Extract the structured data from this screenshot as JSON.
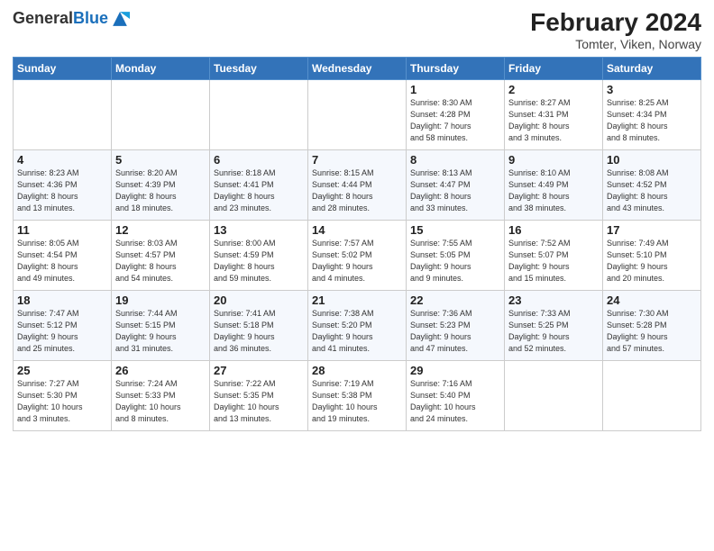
{
  "logo": {
    "general": "General",
    "blue": "Blue"
  },
  "title": "February 2024",
  "subtitle": "Tomter, Viken, Norway",
  "headers": [
    "Sunday",
    "Monday",
    "Tuesday",
    "Wednesday",
    "Thursday",
    "Friday",
    "Saturday"
  ],
  "weeks": [
    [
      {
        "day": "",
        "detail": ""
      },
      {
        "day": "",
        "detail": ""
      },
      {
        "day": "",
        "detail": ""
      },
      {
        "day": "",
        "detail": ""
      },
      {
        "day": "1",
        "detail": "Sunrise: 8:30 AM\nSunset: 4:28 PM\nDaylight: 7 hours\nand 58 minutes."
      },
      {
        "day": "2",
        "detail": "Sunrise: 8:27 AM\nSunset: 4:31 PM\nDaylight: 8 hours\nand 3 minutes."
      },
      {
        "day": "3",
        "detail": "Sunrise: 8:25 AM\nSunset: 4:34 PM\nDaylight: 8 hours\nand 8 minutes."
      }
    ],
    [
      {
        "day": "4",
        "detail": "Sunrise: 8:23 AM\nSunset: 4:36 PM\nDaylight: 8 hours\nand 13 minutes."
      },
      {
        "day": "5",
        "detail": "Sunrise: 8:20 AM\nSunset: 4:39 PM\nDaylight: 8 hours\nand 18 minutes."
      },
      {
        "day": "6",
        "detail": "Sunrise: 8:18 AM\nSunset: 4:41 PM\nDaylight: 8 hours\nand 23 minutes."
      },
      {
        "day": "7",
        "detail": "Sunrise: 8:15 AM\nSunset: 4:44 PM\nDaylight: 8 hours\nand 28 minutes."
      },
      {
        "day": "8",
        "detail": "Sunrise: 8:13 AM\nSunset: 4:47 PM\nDaylight: 8 hours\nand 33 minutes."
      },
      {
        "day": "9",
        "detail": "Sunrise: 8:10 AM\nSunset: 4:49 PM\nDaylight: 8 hours\nand 38 minutes."
      },
      {
        "day": "10",
        "detail": "Sunrise: 8:08 AM\nSunset: 4:52 PM\nDaylight: 8 hours\nand 43 minutes."
      }
    ],
    [
      {
        "day": "11",
        "detail": "Sunrise: 8:05 AM\nSunset: 4:54 PM\nDaylight: 8 hours\nand 49 minutes."
      },
      {
        "day": "12",
        "detail": "Sunrise: 8:03 AM\nSunset: 4:57 PM\nDaylight: 8 hours\nand 54 minutes."
      },
      {
        "day": "13",
        "detail": "Sunrise: 8:00 AM\nSunset: 4:59 PM\nDaylight: 8 hours\nand 59 minutes."
      },
      {
        "day": "14",
        "detail": "Sunrise: 7:57 AM\nSunset: 5:02 PM\nDaylight: 9 hours\nand 4 minutes."
      },
      {
        "day": "15",
        "detail": "Sunrise: 7:55 AM\nSunset: 5:05 PM\nDaylight: 9 hours\nand 9 minutes."
      },
      {
        "day": "16",
        "detail": "Sunrise: 7:52 AM\nSunset: 5:07 PM\nDaylight: 9 hours\nand 15 minutes."
      },
      {
        "day": "17",
        "detail": "Sunrise: 7:49 AM\nSunset: 5:10 PM\nDaylight: 9 hours\nand 20 minutes."
      }
    ],
    [
      {
        "day": "18",
        "detail": "Sunrise: 7:47 AM\nSunset: 5:12 PM\nDaylight: 9 hours\nand 25 minutes."
      },
      {
        "day": "19",
        "detail": "Sunrise: 7:44 AM\nSunset: 5:15 PM\nDaylight: 9 hours\nand 31 minutes."
      },
      {
        "day": "20",
        "detail": "Sunrise: 7:41 AM\nSunset: 5:18 PM\nDaylight: 9 hours\nand 36 minutes."
      },
      {
        "day": "21",
        "detail": "Sunrise: 7:38 AM\nSunset: 5:20 PM\nDaylight: 9 hours\nand 41 minutes."
      },
      {
        "day": "22",
        "detail": "Sunrise: 7:36 AM\nSunset: 5:23 PM\nDaylight: 9 hours\nand 47 minutes."
      },
      {
        "day": "23",
        "detail": "Sunrise: 7:33 AM\nSunset: 5:25 PM\nDaylight: 9 hours\nand 52 minutes."
      },
      {
        "day": "24",
        "detail": "Sunrise: 7:30 AM\nSunset: 5:28 PM\nDaylight: 9 hours\nand 57 minutes."
      }
    ],
    [
      {
        "day": "25",
        "detail": "Sunrise: 7:27 AM\nSunset: 5:30 PM\nDaylight: 10 hours\nand 3 minutes."
      },
      {
        "day": "26",
        "detail": "Sunrise: 7:24 AM\nSunset: 5:33 PM\nDaylight: 10 hours\nand 8 minutes."
      },
      {
        "day": "27",
        "detail": "Sunrise: 7:22 AM\nSunset: 5:35 PM\nDaylight: 10 hours\nand 13 minutes."
      },
      {
        "day": "28",
        "detail": "Sunrise: 7:19 AM\nSunset: 5:38 PM\nDaylight: 10 hours\nand 19 minutes."
      },
      {
        "day": "29",
        "detail": "Sunrise: 7:16 AM\nSunset: 5:40 PM\nDaylight: 10 hours\nand 24 minutes."
      },
      {
        "day": "",
        "detail": ""
      },
      {
        "day": "",
        "detail": ""
      }
    ]
  ]
}
